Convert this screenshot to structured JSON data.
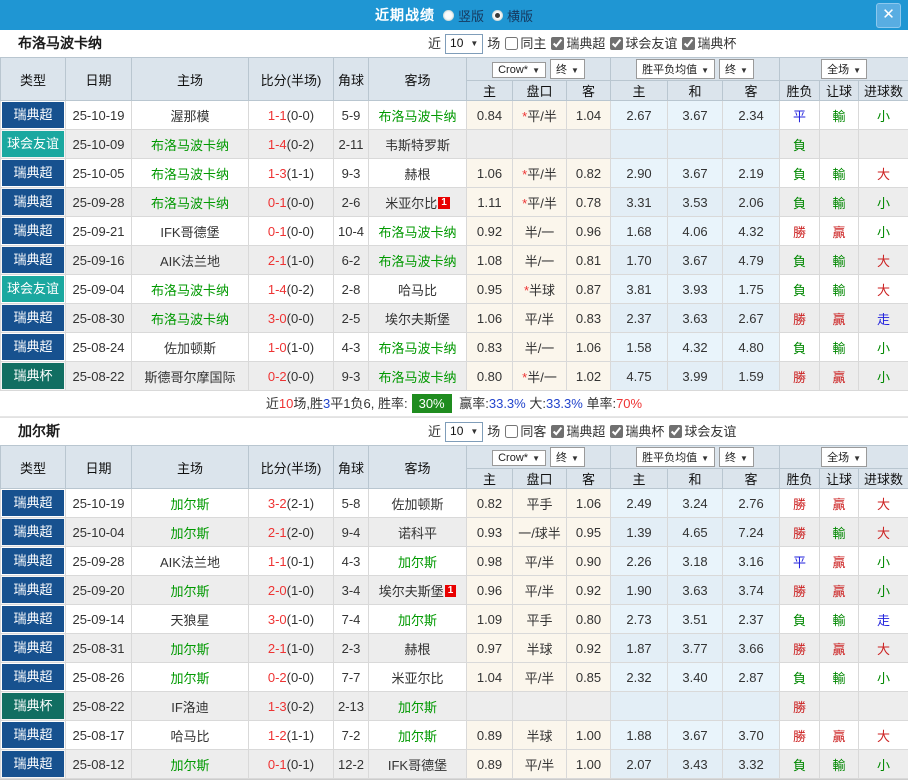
{
  "titlebar": {
    "title": "近期战绩",
    "radio_vertical": "竖版",
    "radio_horizontal": "横版",
    "close": "✕"
  },
  "table_columns": {
    "widths": [
      65,
      66,
      117,
      85,
      35,
      98,
      46,
      54,
      44,
      57,
      55,
      57,
      40,
      39,
      50
    ],
    "main_headers": [
      "类型",
      "日期",
      "主场",
      "比分(半场)",
      "角球",
      "客场"
    ],
    "sub_headers": [
      "主",
      "盘口",
      "客",
      "主",
      "和",
      "客",
      "胜负",
      "让球",
      "进球数"
    ],
    "dropdowns": {
      "odds_company": "Crow*",
      "odds_term": "终",
      "avg": "胜平负均值",
      "avg_term": "终",
      "scope": "全场"
    }
  },
  "league_colors": {
    "瑞典超": "#17518f",
    "球会友谊": "#1ba8a0",
    "瑞典杯": "#116e62"
  },
  "result_colors": {
    "勝": "#cc2222",
    "贏": "#cc2222",
    "大": "#cc2222",
    "負": "#008800",
    "輸": "#008800",
    "小": "#008800",
    "平": "#2222dd",
    "走": "#2222dd"
  },
  "sections": [
    {
      "team": "布洛马波卡纳",
      "controls": {
        "near_label": "近",
        "count": "10",
        "games_label": "场",
        "venue": {
          "label": "同主",
          "checked": false
        },
        "leagues": [
          {
            "label": "瑞典超",
            "checked": true
          },
          {
            "label": "球会友谊",
            "checked": true
          },
          {
            "label": "瑞典杯",
            "checked": true
          }
        ]
      },
      "rows": [
        {
          "league": "瑞典超",
          "date": "25-10-19",
          "home": "渥那模",
          "score": "1-1",
          "half": "(0-0)",
          "corners": "5-9",
          "away": "布洛马波卡纳",
          "card": "",
          "odds": [
            "0.84",
            "*平/半",
            "1.04"
          ],
          "means": [
            "2.67",
            "3.67",
            "2.34"
          ],
          "results": [
            "平",
            "輸",
            "小"
          ]
        },
        {
          "league": "球会友谊",
          "date": "25-10-09",
          "home": "布洛马波卡纳",
          "score": "1-4",
          "half": "(0-2)",
          "corners": "2-11",
          "away": "韦斯特罗斯",
          "card": "",
          "odds": [
            "",
            "",
            ""
          ],
          "means": [
            "",
            "",
            ""
          ],
          "results": [
            "負",
            "",
            ""
          ]
        },
        {
          "league": "瑞典超",
          "date": "25-10-05",
          "home": "布洛马波卡纳",
          "score": "1-3",
          "half": "(1-1)",
          "corners": "9-3",
          "away": "赫根",
          "card": "",
          "odds": [
            "1.06",
            "*平/半",
            "0.82"
          ],
          "means": [
            "2.90",
            "3.67",
            "2.19"
          ],
          "results": [
            "負",
            "輸",
            "大"
          ]
        },
        {
          "league": "瑞典超",
          "date": "25-09-28",
          "home": "布洛马波卡纳",
          "score": "0-1",
          "half": "(0-0)",
          "corners": "2-6",
          "away": "米亚尔比",
          "card": "1",
          "odds": [
            "1.11",
            "*平/半",
            "0.78"
          ],
          "means": [
            "3.31",
            "3.53",
            "2.06"
          ],
          "results": [
            "負",
            "輸",
            "小"
          ]
        },
        {
          "league": "瑞典超",
          "date": "25-09-21",
          "home": "IFK哥德堡",
          "score": "0-1",
          "half": "(0-0)",
          "corners": "10-4",
          "away": "布洛马波卡纳",
          "card": "",
          "odds": [
            "0.92",
            "半/一",
            "0.96"
          ],
          "means": [
            "1.68",
            "4.06",
            "4.32"
          ],
          "results": [
            "勝",
            "贏",
            "小"
          ]
        },
        {
          "league": "瑞典超",
          "date": "25-09-16",
          "home": "AIK法兰地",
          "score": "2-1",
          "half": "(1-0)",
          "corners": "6-2",
          "away": "布洛马波卡纳",
          "card": "",
          "odds": [
            "1.08",
            "半/一",
            "0.81"
          ],
          "means": [
            "1.70",
            "3.67",
            "4.79"
          ],
          "results": [
            "負",
            "輸",
            "大"
          ]
        },
        {
          "league": "球会友谊",
          "date": "25-09-04",
          "home": "布洛马波卡纳",
          "score": "1-4",
          "half": "(0-2)",
          "corners": "2-8",
          "away": "哈马比",
          "card": "",
          "odds": [
            "0.95",
            "*半球",
            "0.87"
          ],
          "means": [
            "3.81",
            "3.93",
            "1.75"
          ],
          "results": [
            "負",
            "輸",
            "大"
          ]
        },
        {
          "league": "瑞典超",
          "date": "25-08-30",
          "home": "布洛马波卡纳",
          "score": "3-0",
          "half": "(0-0)",
          "corners": "2-5",
          "away": "埃尔夫斯堡",
          "card": "",
          "odds": [
            "1.06",
            "平/半",
            "0.83"
          ],
          "means": [
            "2.37",
            "3.63",
            "2.67"
          ],
          "results": [
            "勝",
            "贏",
            "走"
          ]
        },
        {
          "league": "瑞典超",
          "date": "25-08-24",
          "home": "佐加顿斯",
          "score": "1-0",
          "half": "(1-0)",
          "corners": "4-3",
          "away": "布洛马波卡纳",
          "card": "",
          "odds": [
            "0.83",
            "半/一",
            "1.06"
          ],
          "means": [
            "1.58",
            "4.32",
            "4.80"
          ],
          "results": [
            "負",
            "輸",
            "小"
          ]
        },
        {
          "league": "瑞典杯",
          "date": "25-08-22",
          "home": "斯德哥尔摩国际",
          "score": "0-2",
          "half": "(0-0)",
          "corners": "9-3",
          "away": "布洛马波卡纳",
          "card": "",
          "odds": [
            "0.80",
            "*半/一",
            "1.02"
          ],
          "means": [
            "4.75",
            "3.99",
            "1.59"
          ],
          "results": [
            "勝",
            "贏",
            "小"
          ]
        }
      ],
      "summary_parts": [
        {
          "t": "近",
          "cls": "dk"
        },
        {
          "t": "10",
          "cls": "rd"
        },
        {
          "t": "场,胜",
          "cls": "dk"
        },
        {
          "t": "3",
          "cls": "bl"
        },
        {
          "t": "平",
          "cls": "dk"
        },
        {
          "t": "1",
          "cls": "dk"
        },
        {
          "t": "负",
          "cls": "dk"
        },
        {
          "t": "6, ",
          "cls": "dk"
        },
        {
          "t": "胜率:",
          "cls": "dk"
        },
        {
          "t": "30%",
          "cls": "badge"
        },
        {
          "t": " 赢率:",
          "cls": "dk"
        },
        {
          "t": "33.3%",
          "cls": "bl"
        },
        {
          "t": " 大:",
          "cls": "dk"
        },
        {
          "t": "33.3%",
          "cls": "bl"
        },
        {
          "t": " 单率:",
          "cls": "dk"
        },
        {
          "t": "70%",
          "cls": "rd"
        }
      ]
    },
    {
      "team": "加尔斯",
      "controls": {
        "near_label": "近",
        "count": "10",
        "games_label": "场",
        "venue": {
          "label": "同客",
          "checked": false
        },
        "leagues": [
          {
            "label": "瑞典超",
            "checked": true
          },
          {
            "label": "瑞典杯",
            "checked": true
          },
          {
            "label": "球会友谊",
            "checked": true
          }
        ]
      },
      "rows": [
        {
          "league": "瑞典超",
          "date": "25-10-19",
          "home": "加尔斯",
          "score": "3-2",
          "half": "(2-1)",
          "corners": "5-8",
          "away": "佐加顿斯",
          "card": "",
          "odds": [
            "0.82",
            "平手",
            "1.06"
          ],
          "means": [
            "2.49",
            "3.24",
            "2.76"
          ],
          "results": [
            "勝",
            "贏",
            "大"
          ]
        },
        {
          "league": "瑞典超",
          "date": "25-10-04",
          "home": "加尔斯",
          "score": "2-1",
          "half": "(2-0)",
          "corners": "9-4",
          "away": "诺科平",
          "card": "",
          "odds": [
            "0.93",
            "一/球半",
            "0.95"
          ],
          "means": [
            "1.39",
            "4.65",
            "7.24"
          ],
          "results": [
            "勝",
            "輸",
            "大"
          ]
        },
        {
          "league": "瑞典超",
          "date": "25-09-28",
          "home": "AIK法兰地",
          "score": "1-1",
          "half": "(0-1)",
          "corners": "4-3",
          "away": "加尔斯",
          "card": "",
          "odds": [
            "0.98",
            "平/半",
            "0.90"
          ],
          "means": [
            "2.26",
            "3.18",
            "3.16"
          ],
          "results": [
            "平",
            "贏",
            "小"
          ]
        },
        {
          "league": "瑞典超",
          "date": "25-09-20",
          "home": "加尔斯",
          "score": "2-0",
          "half": "(1-0)",
          "corners": "3-4",
          "away": "埃尔夫斯堡",
          "card": "1",
          "odds": [
            "0.96",
            "平/半",
            "0.92"
          ],
          "means": [
            "1.90",
            "3.63",
            "3.74"
          ],
          "results": [
            "勝",
            "贏",
            "小"
          ]
        },
        {
          "league": "瑞典超",
          "date": "25-09-14",
          "home": "天狼星",
          "score": "3-0",
          "half": "(1-0)",
          "corners": "7-4",
          "away": "加尔斯",
          "card": "",
          "odds": [
            "1.09",
            "平手",
            "0.80"
          ],
          "means": [
            "2.73",
            "3.51",
            "2.37"
          ],
          "results": [
            "負",
            "輸",
            "走"
          ]
        },
        {
          "league": "瑞典超",
          "date": "25-08-31",
          "home": "加尔斯",
          "score": "2-1",
          "half": "(1-0)",
          "corners": "2-3",
          "away": "赫根",
          "card": "",
          "odds": [
            "0.97",
            "半球",
            "0.92"
          ],
          "means": [
            "1.87",
            "3.77",
            "3.66"
          ],
          "results": [
            "勝",
            "贏",
            "大"
          ]
        },
        {
          "league": "瑞典超",
          "date": "25-08-26",
          "home": "加尔斯",
          "score": "0-2",
          "half": "(0-0)",
          "corners": "7-7",
          "away": "米亚尔比",
          "card": "",
          "odds": [
            "1.04",
            "平/半",
            "0.85"
          ],
          "means": [
            "2.32",
            "3.40",
            "2.87"
          ],
          "results": [
            "負",
            "輸",
            "小"
          ]
        },
        {
          "league": "瑞典杯",
          "date": "25-08-22",
          "home": "IF洛迪",
          "score": "1-3",
          "half": "(0-2)",
          "corners": "2-13",
          "away": "加尔斯",
          "card": "",
          "odds": [
            "",
            "",
            ""
          ],
          "means": [
            "",
            "",
            ""
          ],
          "results": [
            "勝",
            "",
            ""
          ]
        },
        {
          "league": "瑞典超",
          "date": "25-08-17",
          "home": "哈马比",
          "score": "1-2",
          "half": "(1-1)",
          "corners": "7-2",
          "away": "加尔斯",
          "card": "",
          "odds": [
            "0.89",
            "半球",
            "1.00"
          ],
          "means": [
            "1.88",
            "3.67",
            "3.70"
          ],
          "results": [
            "勝",
            "贏",
            "大"
          ]
        },
        {
          "league": "瑞典超",
          "date": "25-08-12",
          "home": "加尔斯",
          "score": "0-1",
          "half": "(0-1)",
          "corners": "12-2",
          "away": "IFK哥德堡",
          "card": "",
          "odds": [
            "0.89",
            "平/半",
            "1.00"
          ],
          "means": [
            "2.07",
            "3.43",
            "3.32"
          ],
          "results": [
            "負",
            "輸",
            "小"
          ]
        }
      ]
    }
  ]
}
